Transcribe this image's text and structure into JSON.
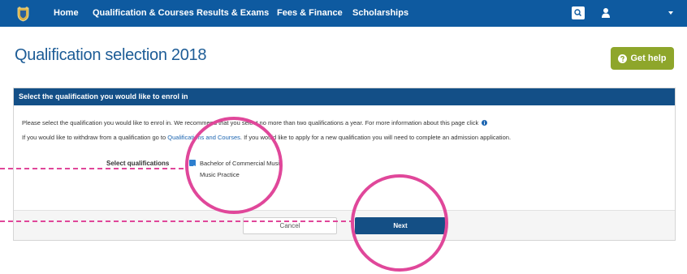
{
  "nav": {
    "items": [
      {
        "id": "home",
        "label": "Home"
      },
      {
        "id": "qualification-courses",
        "label": "Qualification & Courses"
      },
      {
        "id": "results-exams",
        "label": "Results & Exams"
      },
      {
        "id": "fees-finance",
        "label": "Fees & Finance"
      },
      {
        "id": "scholarships",
        "label": "Scholarships"
      }
    ],
    "icons": [
      "crest-logo",
      "search-icon",
      "user-icon",
      "caret-down-icon"
    ]
  },
  "page": {
    "title": "Qualification selection 2018",
    "help_label": "Get help",
    "help_icon": "question-circle-icon"
  },
  "panel": {
    "heading": "Select the qualification you would like to enrol in",
    "line1": "Please select the qualification you would like to enrol in. We recommend that you select no more than two qualifications a year. For more information about this page click",
    "line2_before": "If you would like to withdraw from a qualification go to",
    "line2_link": "Qualifications and Courses",
    "line2_after": ". If you would like to apply for a new qualification you will need to complete an admission application.",
    "select_label": "Select qualifications",
    "qualification": {
      "name": "Bachelor of Commercial Music",
      "major": "Music Practice",
      "checked": true
    },
    "cancel_label": "Cancel",
    "next_label": "Next"
  },
  "colors": {
    "nav": "#0e5aa0",
    "panel_head": "#134f87",
    "help": "#8ea62b",
    "annotation": "#e0479a"
  }
}
